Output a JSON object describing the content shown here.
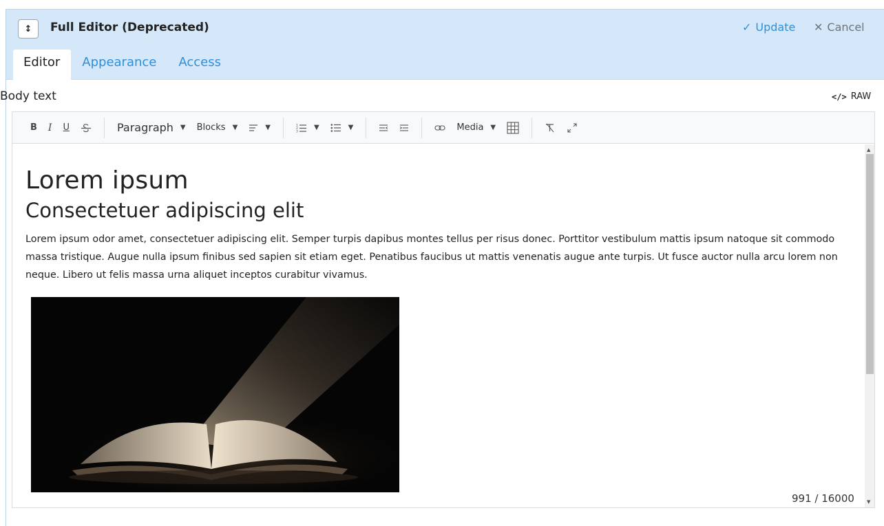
{
  "header": {
    "drag_icon": "drag-vertical-icon",
    "title": "Full Editor (Deprecated)",
    "update_label": "Update",
    "cancel_label": "Cancel",
    "accent_color": "#2f8fd8",
    "background_color": "#d4e8f9"
  },
  "tabs": [
    {
      "label": "Editor",
      "active": true
    },
    {
      "label": "Appearance",
      "active": false
    },
    {
      "label": "Access",
      "active": false
    }
  ],
  "field": {
    "label": "Body text",
    "raw_code": "</>",
    "raw_label": "RAW"
  },
  "toolbar": {
    "bold": "B",
    "italic": "I",
    "underline": "U",
    "paragraph": "Paragraph",
    "blocks": "Blocks",
    "media": "Media"
  },
  "content": {
    "heading1": "Lorem ipsum",
    "heading2": "Consectetuer adipiscing elit",
    "paragraph": "Lorem ipsum odor amet, consectetuer adipiscing elit. Semper turpis dapibus montes tellus per risus donec. Porttitor vestibulum mattis ipsum natoque sit commodo massa tristique. Augue nulla ipsum finibus sed sapien sit etiam eget. Penatibus faucibus ut mattis venenatis augue ante turpis. Ut fusce auctor nulla arcu lorem non neque. Libero ut felis massa urna aliquet inceptos curabitur vivamus."
  },
  "counter": "991 / 16000"
}
